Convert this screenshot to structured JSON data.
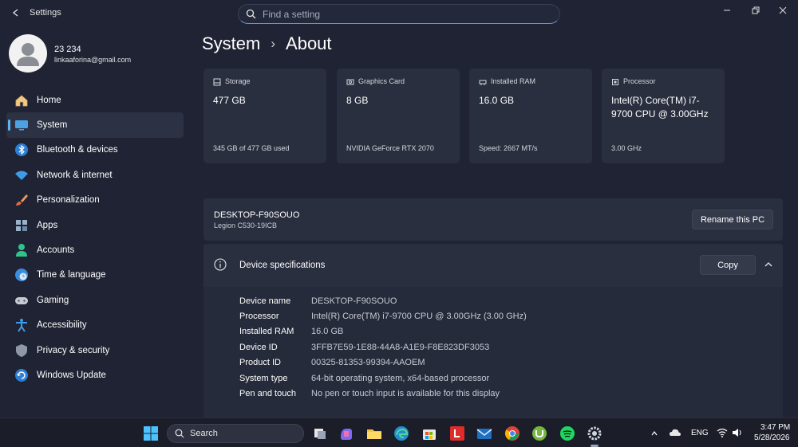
{
  "window": {
    "app_title": "Settings",
    "search_placeholder": "Find a setting"
  },
  "profile": {
    "name": "23 234",
    "email": "linkaaforina@gmail.com"
  },
  "sidebar": {
    "items": [
      {
        "label": "Home",
        "icon": "home-icon"
      },
      {
        "label": "System",
        "icon": "system-icon",
        "active": true
      },
      {
        "label": "Bluetooth & devices",
        "icon": "bluetooth-icon"
      },
      {
        "label": "Network & internet",
        "icon": "wifi-icon"
      },
      {
        "label": "Personalization",
        "icon": "brush-icon"
      },
      {
        "label": "Apps",
        "icon": "apps-icon"
      },
      {
        "label": "Accounts",
        "icon": "person-icon"
      },
      {
        "label": "Time & language",
        "icon": "globe-clock-icon"
      },
      {
        "label": "Gaming",
        "icon": "gamepad-icon"
      },
      {
        "label": "Accessibility",
        "icon": "accessibility-icon"
      },
      {
        "label": "Privacy & security",
        "icon": "shield-icon"
      },
      {
        "label": "Windows Update",
        "icon": "update-icon"
      }
    ]
  },
  "breadcrumb": {
    "parent": "System",
    "separator": "›",
    "current": "About"
  },
  "cards": [
    {
      "label": "Storage",
      "value": "477 GB",
      "detail": "345 GB of 477 GB used",
      "icon": "storage-icon"
    },
    {
      "label": "Graphics Card",
      "value": "8 GB",
      "detail": "NVIDIA GeForce RTX 2070",
      "icon": "graphics-card-icon"
    },
    {
      "label": "Installed RAM",
      "value": "16.0 GB",
      "detail": "Speed: 2667 MT/s",
      "icon": "ram-icon"
    },
    {
      "label": "Processor",
      "value": "Intel(R) Core(TM) i7-9700 CPU @ 3.00GHz",
      "detail": "3.00 GHz",
      "icon": "processor-icon"
    }
  ],
  "pc": {
    "name": "DESKTOP-F90SOUO",
    "model": "Legion C530-19ICB",
    "rename_label": "Rename this PC"
  },
  "specs": {
    "title": "Device specifications",
    "copy_label": "Copy",
    "rows": [
      {
        "key": "Device name",
        "value": "DESKTOP-F90SOUO"
      },
      {
        "key": "Processor",
        "value": "Intel(R) Core(TM) i7-9700 CPU @ 3.00GHz (3.00 GHz)"
      },
      {
        "key": "Installed RAM",
        "value": "16.0 GB"
      },
      {
        "key": "Device ID",
        "value": "3FFB7E59-1E88-44A8-A1E9-F8E823DF3053"
      },
      {
        "key": "Product ID",
        "value": "00325-81353-99394-AAOEM"
      },
      {
        "key": "System type",
        "value": "64-bit operating system, x64-based processor"
      },
      {
        "key": "Pen and touch",
        "value": "No pen or touch input is available for this display"
      }
    ]
  },
  "taskbar": {
    "search_label": "Search",
    "language": "ENG",
    "time": "3:47 PM",
    "date": "5/28/2026",
    "apps": [
      "task-view-icon",
      "copilot-icon",
      "file-explorer-icon",
      "edge-icon",
      "store-icon",
      "letter-l-app-icon",
      "mail-icon",
      "chrome-icon",
      "utorrent-icon",
      "spotify-like-icon",
      "settings-gear-icon"
    ]
  },
  "colors": {
    "accent": "#5fb2f2",
    "background": "#1f2333",
    "card": "#2a2f3f"
  }
}
